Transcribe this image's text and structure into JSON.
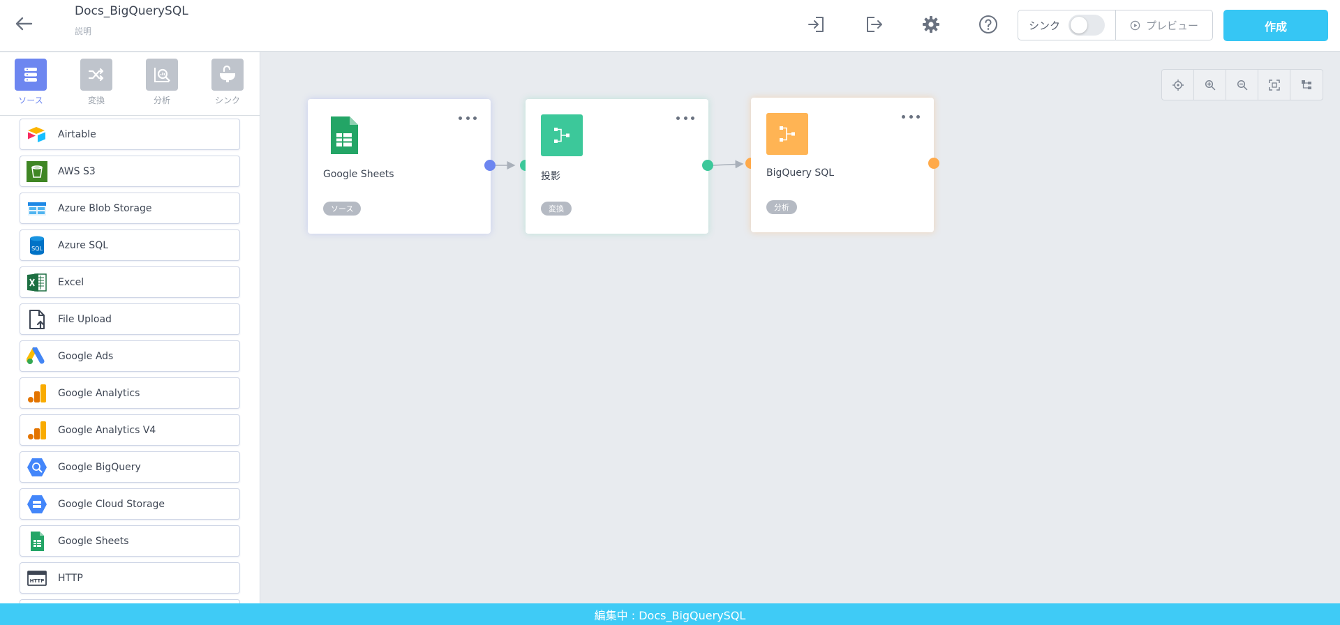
{
  "header": {
    "title": "Docs_BigQuerySQL",
    "description": "説明",
    "icons": [
      "back-arrow-icon",
      "import-icon",
      "export-icon",
      "gear-icon",
      "help-icon"
    ],
    "sync_label": "シンク",
    "sync_enabled": false,
    "preview_label": "プレビュー",
    "create_label": "作成"
  },
  "sidebar": {
    "tabs": [
      {
        "label": "ソース",
        "icon": "database-icon",
        "active": true
      },
      {
        "label": "変換",
        "icon": "shuffle-icon",
        "active": false
      },
      {
        "label": "分析",
        "icon": "analysis-icon",
        "active": false
      },
      {
        "label": "シンク",
        "icon": "sink-icon",
        "active": false
      }
    ],
    "connectors": [
      {
        "label": "Airtable",
        "icon": "airtable-icon"
      },
      {
        "label": "AWS S3",
        "icon": "aws-s3-icon"
      },
      {
        "label": "Azure Blob Storage",
        "icon": "azure-blob-icon"
      },
      {
        "label": "Azure SQL",
        "icon": "azure-sql-icon"
      },
      {
        "label": "Excel",
        "icon": "excel-icon"
      },
      {
        "label": "File Upload",
        "icon": "file-upload-icon"
      },
      {
        "label": "Google Ads",
        "icon": "google-ads-icon"
      },
      {
        "label": "Google Analytics",
        "icon": "google-analytics-icon"
      },
      {
        "label": "Google Analytics V4",
        "icon": "google-analytics-icon"
      },
      {
        "label": "Google BigQuery",
        "icon": "bigquery-icon"
      },
      {
        "label": "Google Cloud Storage",
        "icon": "cloud-storage-icon"
      },
      {
        "label": "Google Sheets",
        "icon": "google-sheets-icon"
      },
      {
        "label": "HTTP",
        "icon": "http-icon"
      }
    ]
  },
  "canvas": {
    "tools": [
      "locate-icon",
      "zoom-in-icon",
      "zoom-out-icon",
      "fit-view-icon",
      "auto-layout-icon"
    ],
    "nodes": [
      {
        "title": "Google Sheets",
        "badge": "ソース",
        "icon": "google-sheets-icon"
      },
      {
        "title": "投影",
        "badge": "変換",
        "icon": "transform-icon"
      },
      {
        "title": "BigQuery SQL",
        "badge": "分析",
        "icon": "analysis-flow-icon"
      }
    ]
  },
  "colors": {
    "accent": "#36c6f4",
    "source": "#6d86f0",
    "transform": "#3cc89a",
    "analysis": "#ffaa4a",
    "footer": "#3fcbf6"
  },
  "footer": {
    "status": "編集中 : Docs_BigQuerySQL"
  }
}
